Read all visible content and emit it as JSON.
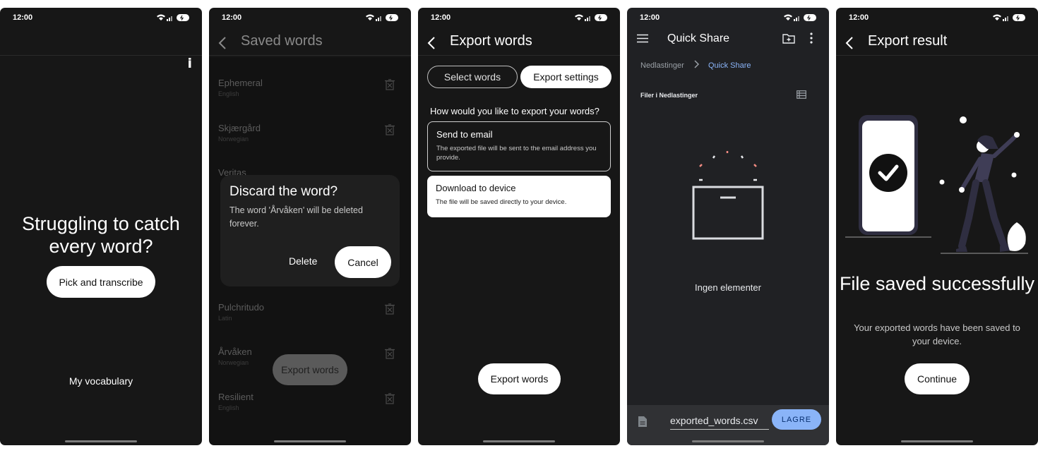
{
  "status": {
    "time": "12:00"
  },
  "screen1": {
    "info_label": "i",
    "headline": "Struggling to catch every word?",
    "pick_button": "Pick and transcribe",
    "vocabulary_link": "My vocabulary"
  },
  "screen2": {
    "title": "Saved words",
    "words": [
      {
        "word": "Ephemeral",
        "language": "English"
      },
      {
        "word": "Skjærgård",
        "language": "Norwegian"
      },
      {
        "word": "Veritas",
        "language": ""
      },
      {
        "word": "Pulchritudo",
        "language": "Latin"
      },
      {
        "word": "Årvåken",
        "language": "Norwegian"
      },
      {
        "word": "Resilient",
        "language": "English"
      }
    ],
    "dialog": {
      "title": "Discard the word?",
      "body": "The word 'Årvåken' will be deleted forever.",
      "delete_label": "Delete",
      "cancel_label": "Cancel"
    },
    "export_button": "Export words"
  },
  "screen3": {
    "title": "Export words",
    "tabs": [
      "Select words",
      "Export settings"
    ],
    "selected_tab": "Export settings",
    "question": "How would you like to export your words?",
    "options": [
      {
        "title": "Send to email",
        "description": "The exported file will be sent to the email address you provide."
      },
      {
        "title": "Download to device",
        "description": "The file will be saved directly to your device."
      }
    ],
    "export_button": "Export words"
  },
  "screen4": {
    "title": "Quick Share",
    "breadcrumb": [
      "Nedlastinger",
      "Quick Share"
    ],
    "section_label": "Filer i Nedlastinger",
    "empty_label": "Ingen elementer",
    "filename": "exported_words.csv",
    "save_label": "LAGRE",
    "accent_color": "#8ab4f8"
  },
  "screen5": {
    "title": "Export result",
    "headline": "File saved successfully",
    "body": "Your exported words have been saved to your device.",
    "continue_button": "Continue"
  }
}
